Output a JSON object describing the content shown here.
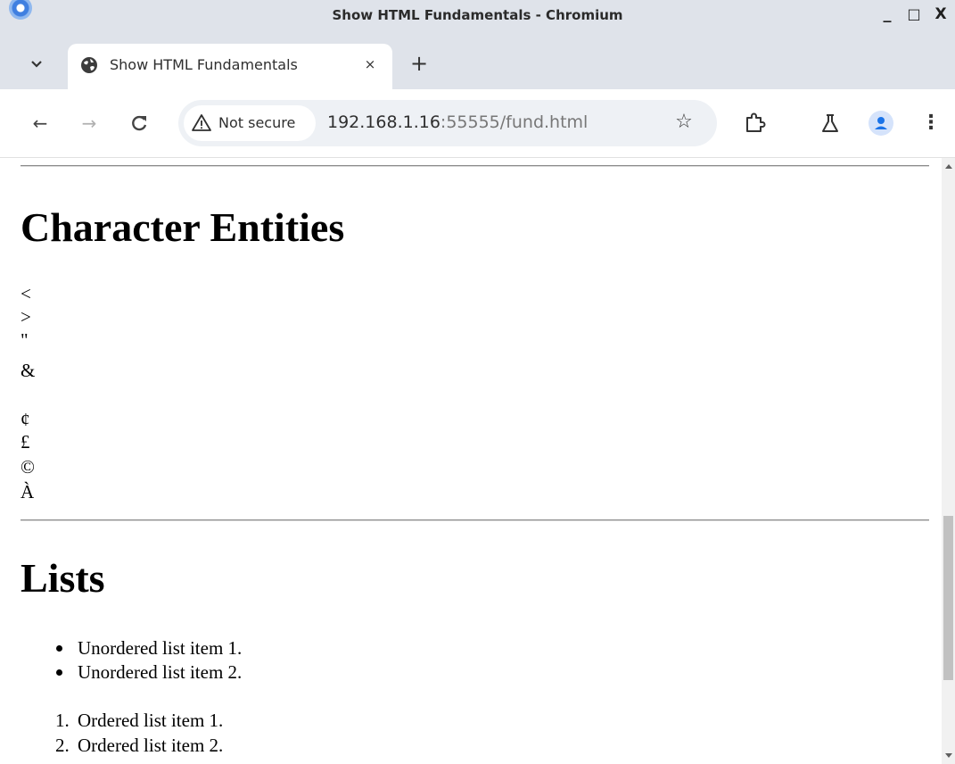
{
  "window": {
    "title": "Show HTML Fundamentals - Chromium",
    "minimize_label": "_",
    "maximize_label": "□",
    "close_label": "X"
  },
  "tabs": [
    {
      "title": "Show HTML Fundamentals",
      "active": true,
      "close_label": "×"
    }
  ],
  "tabstrip": {
    "search_label": "⌄",
    "new_tab_label": "+"
  },
  "toolbar": {
    "back_label": "←",
    "forward_label": "→",
    "reload_label": "C",
    "security_label": "Not secure",
    "url_host": "192.168.1.16",
    "url_rest": ":55555/fund.html",
    "bookmark_label": "☆",
    "menu_label": "⋮"
  },
  "page": {
    "entities_heading": "Character Entities",
    "entities": [
      "<",
      ">",
      "\"",
      "&",
      "",
      "¢",
      "£",
      "©",
      "À"
    ],
    "lists_heading": "Lists",
    "unordered_items": [
      "Unordered list item 1.",
      "Unordered list item 2."
    ],
    "ordered_items": [
      "Ordered list item 1.",
      "Ordered list item 2."
    ],
    "ordered_markers": [
      "1.",
      "2."
    ]
  },
  "scrollbar": {
    "position_fraction": 0.58
  },
  "colors": {
    "frame": "#dfe3ea",
    "omnibox": "#eef1f5",
    "accent": "#1a73e8"
  },
  "icons": {
    "favicon": "globe-icon",
    "security": "warning-triangle-icon",
    "extensions": "puzzle-icon",
    "labs": "flask-icon",
    "profile": "person-icon"
  }
}
